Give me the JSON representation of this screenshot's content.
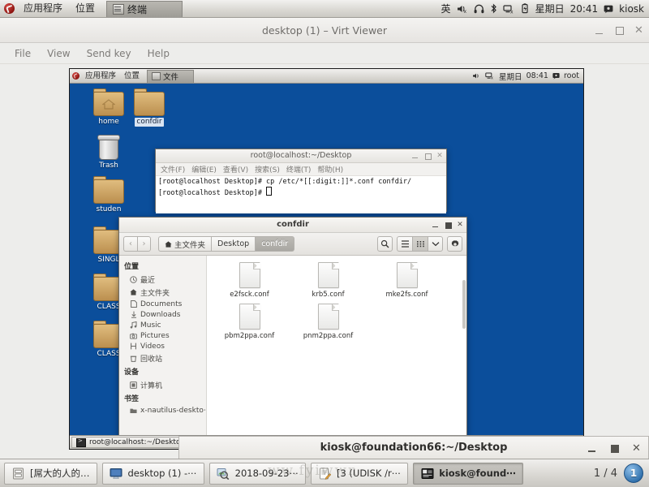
{
  "host_panel": {
    "menus": [
      "应用程序",
      "位置"
    ],
    "window_tab": "终端",
    "tray": {
      "input_method": "英",
      "icons": [
        "volume-muted-icon",
        "headphones-icon",
        "bluetooth-icon",
        "network-disconnected-icon",
        "battery-charging-icon"
      ],
      "day": "星期日",
      "time": "20:41",
      "user": "kiosk"
    }
  },
  "virt_viewer": {
    "title": "desktop (1) – Virt Viewer",
    "menu": [
      "File",
      "View",
      "Send key",
      "Help"
    ],
    "buttons": {
      "minimize": "_",
      "maximize": "□",
      "close": "✕"
    }
  },
  "guest": {
    "panel": {
      "menus": [
        "应用程序",
        "位置"
      ],
      "window_tab": "文件",
      "tray": {
        "day": "星期日",
        "time": "08:41",
        "user": "root"
      }
    },
    "desktop_icons": [
      {
        "label": "home",
        "type": "folder-home",
        "selected": false
      },
      {
        "label": "confdir",
        "type": "folder",
        "selected": true
      },
      {
        "label": "Trash",
        "type": "trash",
        "selected": false
      },
      {
        "label": "studen",
        "type": "folder",
        "selected": false
      },
      {
        "label": "SINGL",
        "type": "folder",
        "selected": false
      },
      {
        "label": "CLASS",
        "type": "folder",
        "selected": false
      },
      {
        "label": "CLASS",
        "type": "folder",
        "selected": false
      }
    ],
    "taskbar": {
      "items": [
        {
          "label": "root@localhost:~/Desktop",
          "icon": "terminal-icon"
        }
      ]
    }
  },
  "terminal": {
    "title": "root@localhost:~/Desktop",
    "menu": [
      "文件(F)",
      "编辑(E)",
      "查看(V)",
      "搜索(S)",
      "终端(T)",
      "帮助(H)"
    ],
    "lines": [
      "[root@localhost Desktop]# cp /etc/*[[:digit:]]*.conf confdir/",
      "[root@localhost Desktop]# "
    ]
  },
  "nautilus": {
    "title": "confdir",
    "breadcrumbs": [
      {
        "label": "主文件夹",
        "icon": "home-icon",
        "active": false
      },
      {
        "label": "Desktop",
        "icon": "",
        "active": false
      },
      {
        "label": "confdir",
        "icon": "",
        "active": true
      }
    ],
    "toolbar_icons": [
      "search-icon",
      "list-view-icon",
      "grid-view-icon",
      "chevron-down-icon",
      "gear-icon"
    ],
    "sidebar": [
      {
        "type": "header",
        "label": "位置"
      },
      {
        "type": "item",
        "label": "最近",
        "icon": "clock-icon"
      },
      {
        "type": "item",
        "label": "主文件夹",
        "icon": "home-icon"
      },
      {
        "type": "item",
        "label": "Documents",
        "icon": "document-icon"
      },
      {
        "type": "item",
        "label": "Downloads",
        "icon": "download-icon"
      },
      {
        "type": "item",
        "label": "Music",
        "icon": "music-icon"
      },
      {
        "type": "item",
        "label": "Pictures",
        "icon": "camera-icon"
      },
      {
        "type": "item",
        "label": "Videos",
        "icon": "film-icon"
      },
      {
        "type": "item",
        "label": "回收站",
        "icon": "trash-icon"
      },
      {
        "type": "header",
        "label": "设备"
      },
      {
        "type": "item",
        "label": "计算机",
        "icon": "computer-icon"
      },
      {
        "type": "header",
        "label": "书签"
      },
      {
        "type": "item",
        "label": "x-nautilus-deskto⋯",
        "icon": "folder-icon"
      }
    ],
    "files": [
      {
        "name": "e2fsck.conf"
      },
      {
        "name": "krb5.conf"
      },
      {
        "name": "mke2fs.conf"
      },
      {
        "name": "pbm2ppa.conf"
      },
      {
        "name": "pnm2ppa.conf"
      }
    ]
  },
  "kiosk_window": {
    "title": "kiosk@foundation66:~/Desktop",
    "buttons": {
      "minimize": "_",
      "maximize": "□",
      "close": "✕"
    }
  },
  "host_taskbar": {
    "items": [
      {
        "label": "[屌大的人的…",
        "icon": "archive-icon",
        "active": false
      },
      {
        "label": "desktop (1) -⋯",
        "icon": "monitor-icon",
        "active": false
      },
      {
        "label": "2018-09-23⋯",
        "icon": "image-viewer-icon",
        "active": false
      },
      {
        "label": "[3 (UDISK /r⋯",
        "icon": "editor-icon",
        "active": false
      },
      {
        "label": "kiosk@found⋯",
        "icon": "terminal-icon",
        "active": true
      }
    ],
    "pager_label": "1 / 4",
    "pager_current": "1"
  },
  "watermark": "ww.fyiwwn"
}
